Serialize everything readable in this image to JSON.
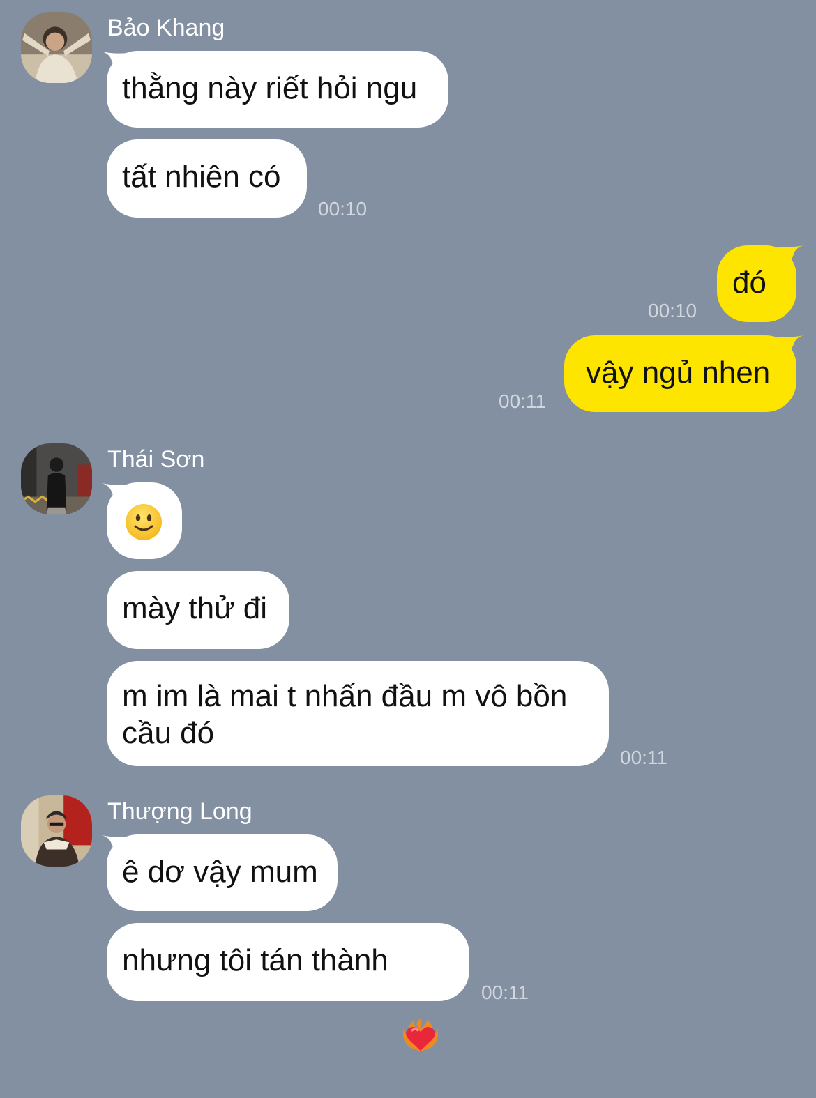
{
  "chat": {
    "groups": [
      {
        "sender": "Bảo Khang",
        "messages": [
          "thằng này riết hỏi ngu",
          "tất nhiên có"
        ],
        "time": "00:10"
      },
      {
        "mine": true,
        "messages": [
          {
            "text": "đó",
            "time": "00:10"
          },
          {
            "text": "vậy ngủ nhen",
            "time": "00:11"
          }
        ]
      },
      {
        "sender": "Thái Sơn",
        "messages": [
          "🙂",
          "mày thử đi",
          "m im là mai t nhấn đầu m vô bồn\ncầu đó"
        ],
        "time": "00:11"
      },
      {
        "sender": "Thượng Long",
        "messages": [
          "ê dơ vậy mum",
          "nhưng tôi tán thành"
        ],
        "time": "00:11"
      }
    ]
  },
  "icons": {
    "emoji_in_message": "slightly-smiling-face-icon",
    "emoji_after_text": "heart-on-fire-icon"
  },
  "colors": {
    "background": "#8390a2",
    "incoming_bubble": "#ffffff",
    "outgoing_bubble": "#fee500",
    "timestamp": "#d2d7df"
  }
}
